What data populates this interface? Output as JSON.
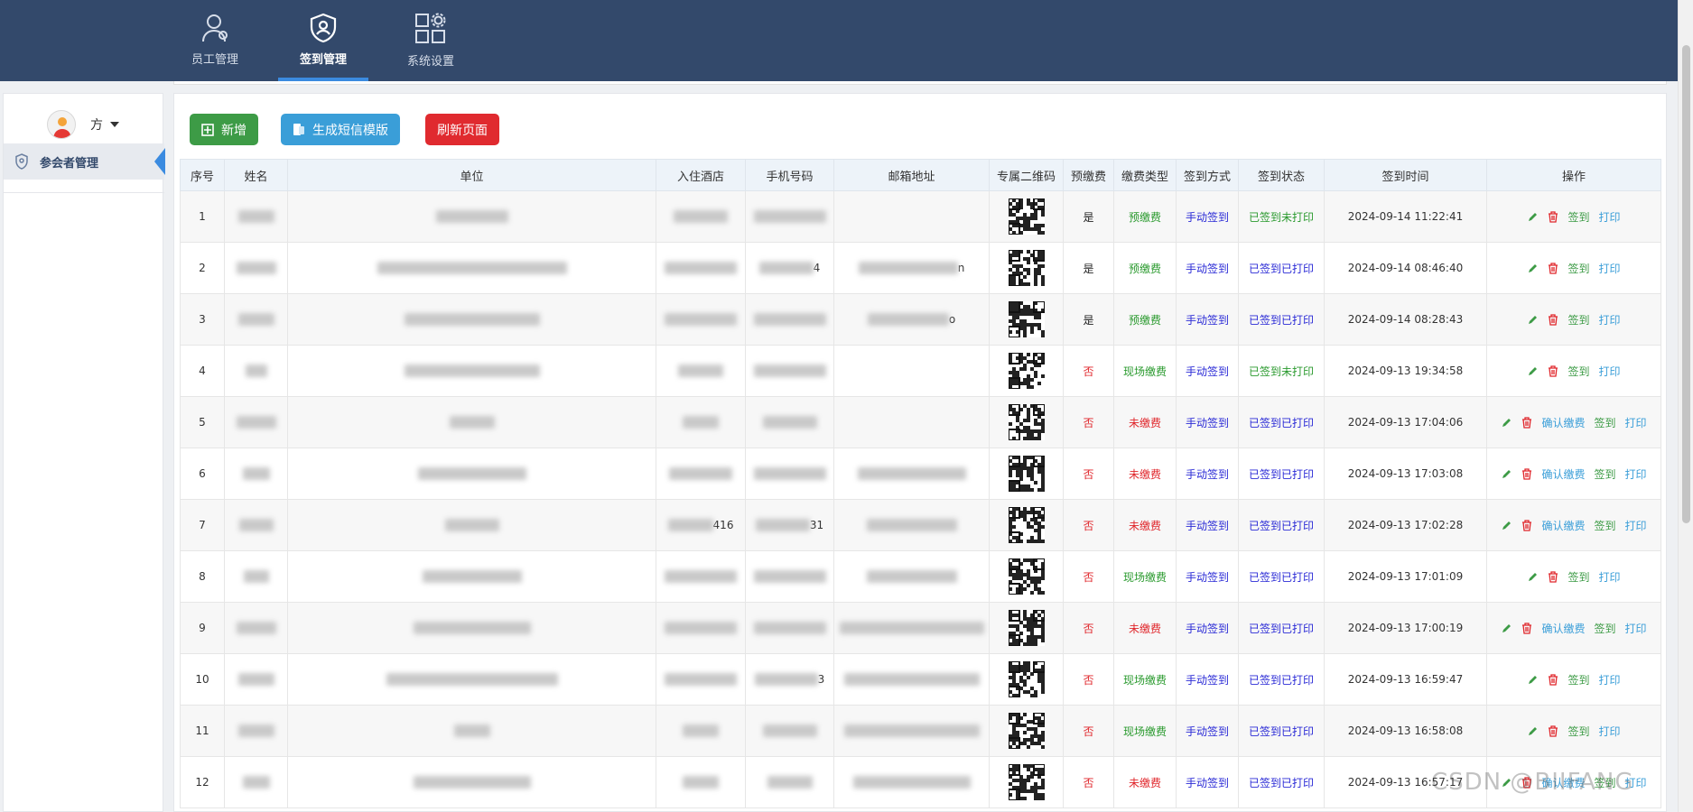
{
  "nav": {
    "tabs": [
      {
        "label": "员工管理",
        "icon": "employee-icon",
        "active": false
      },
      {
        "label": "签到管理",
        "icon": "shield-user-icon",
        "active": true
      },
      {
        "label": "系统设置",
        "icon": "settings-grid-icon",
        "active": false
      }
    ]
  },
  "sidebar": {
    "user_name": "方",
    "menu": [
      {
        "label": "参会者管理",
        "icon": "shield-icon"
      }
    ]
  },
  "toolbar": {
    "add_label": "新增",
    "sms_label": "生成短信模版",
    "refresh_label": "刷新页面"
  },
  "table": {
    "columns": [
      "序号",
      "姓名",
      "单位",
      "入住酒店",
      "手机号码",
      "邮箱地址",
      "专属二维码",
      "预缴费",
      "缴费类型",
      "签到方式",
      "签到状态",
      "签到时间",
      "操作"
    ],
    "op_labels": {
      "confirm": "确认缴费",
      "sign": "签到",
      "print": "打印"
    },
    "rows": [
      {
        "no": "1",
        "hotel_suffix": "",
        "phone_suffix": "",
        "email_suffix": "",
        "prepay": "是",
        "pay_type": "预缴费",
        "method": "手动签到",
        "status": "已签到未打印",
        "time": "2024-09-14 11:22:41",
        "confirm": false
      },
      {
        "no": "2",
        "hotel_suffix": "",
        "phone_suffix": "4",
        "email_suffix": "n",
        "prepay": "是",
        "pay_type": "预缴费",
        "method": "手动签到",
        "status": "已签到已打印",
        "time": "2024-09-14 08:46:40",
        "confirm": false
      },
      {
        "no": "3",
        "hotel_suffix": "",
        "phone_suffix": "",
        "email_suffix": "o",
        "prepay": "是",
        "pay_type": "预缴费",
        "method": "手动签到",
        "status": "已签到已打印",
        "time": "2024-09-14 08:28:43",
        "confirm": false
      },
      {
        "no": "4",
        "hotel_suffix": "",
        "phone_suffix": "",
        "email_suffix": "",
        "prepay": "否",
        "pay_type": "现场缴费",
        "method": "手动签到",
        "status": "已签到未打印",
        "time": "2024-09-13 19:34:58",
        "confirm": false
      },
      {
        "no": "5",
        "hotel_suffix": "",
        "phone_suffix": "",
        "email_suffix": "",
        "prepay": "否",
        "pay_type": "未缴费",
        "method": "手动签到",
        "status": "已签到已打印",
        "time": "2024-09-13 17:04:06",
        "confirm": true
      },
      {
        "no": "6",
        "hotel_suffix": "",
        "phone_suffix": "",
        "email_suffix": "",
        "prepay": "否",
        "pay_type": "未缴费",
        "method": "手动签到",
        "status": "已签到已打印",
        "time": "2024-09-13 17:03:08",
        "confirm": true
      },
      {
        "no": "7",
        "hotel_suffix": "416",
        "phone_suffix": "31",
        "email_suffix": "",
        "prepay": "否",
        "pay_type": "未缴费",
        "method": "手动签到",
        "status": "已签到已打印",
        "time": "2024-09-13 17:02:28",
        "confirm": true
      },
      {
        "no": "8",
        "hotel_suffix": "",
        "phone_suffix": "",
        "email_suffix": "",
        "prepay": "否",
        "pay_type": "现场缴费",
        "method": "手动签到",
        "status": "已签到已打印",
        "time": "2024-09-13 17:01:09",
        "confirm": false
      },
      {
        "no": "9",
        "hotel_suffix": "",
        "phone_suffix": "",
        "email_suffix": "",
        "prepay": "否",
        "pay_type": "未缴费",
        "method": "手动签到",
        "status": "已签到已打印",
        "time": "2024-09-13 17:00:19",
        "confirm": true
      },
      {
        "no": "10",
        "hotel_suffix": "",
        "phone_suffix": "3",
        "email_suffix": "",
        "prepay": "否",
        "pay_type": "现场缴费",
        "method": "手动签到",
        "status": "已签到已打印",
        "time": "2024-09-13 16:59:47",
        "confirm": false
      },
      {
        "no": "11",
        "hotel_suffix": "",
        "phone_suffix": "",
        "email_suffix": "",
        "prepay": "否",
        "pay_type": "现场缴费",
        "method": "手动签到",
        "status": "已签到已打印",
        "time": "2024-09-13 16:58:08",
        "confirm": false
      },
      {
        "no": "12",
        "hotel_suffix": "",
        "phone_suffix": "",
        "email_suffix": "",
        "prepay": "否",
        "pay_type": "未缴费",
        "method": "手动签到",
        "status": "已签到已打印",
        "time": "2024-09-13 16:57:17",
        "confirm": true
      }
    ]
  },
  "watermark": "CSDN @BIIFANG",
  "colors": {
    "nav_bg": "#33496b",
    "add": "#3d9b46",
    "sms": "#3a9ed8",
    "refresh": "#e02a2f"
  }
}
